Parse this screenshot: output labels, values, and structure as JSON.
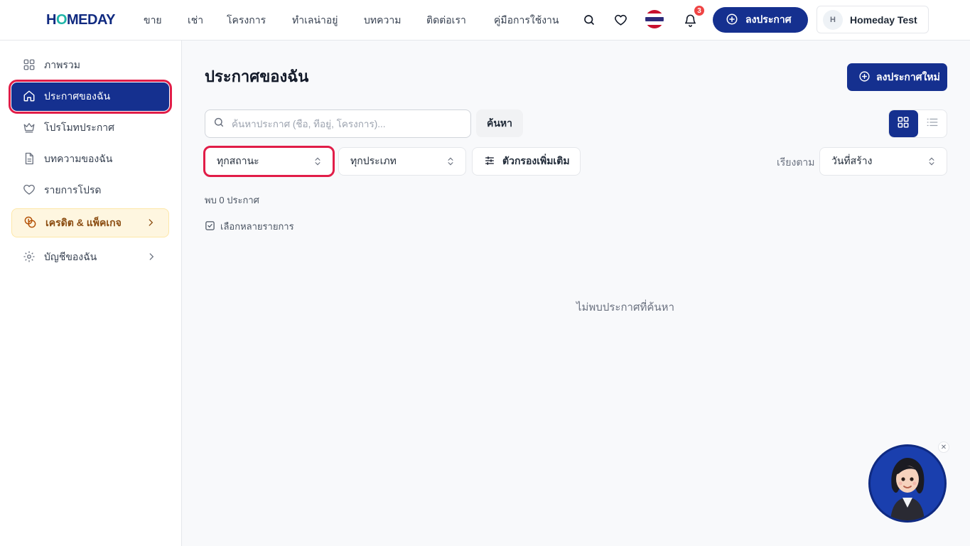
{
  "header": {
    "logo_prefix": "H",
    "logo_o": "O",
    "logo_suffix": "MEDAY",
    "nav": [
      {
        "label": "ขาย"
      },
      {
        "label": "เช่า"
      },
      {
        "label": "โครงการ"
      },
      {
        "label": "ทำเลน่าอยู่"
      },
      {
        "label": "บทความ"
      },
      {
        "label": "ติดต่อเรา"
      },
      {
        "label": "คู่มือการใช้งาน"
      }
    ],
    "notification_count": "3",
    "post_button": "ลงประกาศ",
    "user_initial": "H",
    "user_name": "Homeday Test",
    "icons": {
      "search": "search-icon",
      "favorite": "heart-icon",
      "language": "thai-flag-icon",
      "notifications": "bell-icon"
    }
  },
  "sidebar": {
    "items": [
      {
        "label": "ภาพรวม",
        "icon": "dashboard-grid-icon"
      },
      {
        "label": "ประกาศของฉัน",
        "icon": "home-icon",
        "active": true
      },
      {
        "label": "โปรโมทประกาศ",
        "icon": "crown-icon"
      },
      {
        "label": "บทความของฉัน",
        "icon": "document-icon"
      },
      {
        "label": "รายการโปรด",
        "icon": "heart-icon"
      },
      {
        "label": "เครดิต & แพ็คเกจ",
        "icon": "coins-icon"
      },
      {
        "label": "บัญชีของฉัน",
        "icon": "gear-icon"
      }
    ]
  },
  "main": {
    "title": "ประกาศของฉัน",
    "new_post_button": "ลงประกาศใหม่",
    "search": {
      "placeholder": "ค้นหาประกาศ (ชื่อ, ที่อยู่, โครงการ)...",
      "value": "",
      "button": "ค้นหา"
    },
    "view_mode": "grid",
    "filters": {
      "status": "ทุกสถานะ",
      "type": "ทุกประเภท",
      "more": "ตัวกรองเพิ่มเติม",
      "sort_label": "เรียงตาม",
      "sort": "วันที่สร้าง"
    },
    "result_count": "พบ 0 ประกาศ",
    "multi_select": "เลือกหลายรายการ",
    "empty_message": "ไม่พบประกาศที่ค้นหา"
  },
  "colors": {
    "primary": "#15308f",
    "accent": "#1fb5a8",
    "highlight": "#e11d48",
    "badge": "#ef4444",
    "credit_bg": "#fef6e0"
  }
}
